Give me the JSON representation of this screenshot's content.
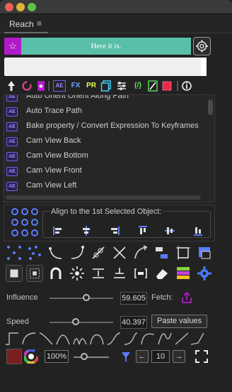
{
  "window": {
    "title_dots": [
      "close",
      "minimize",
      "zoom"
    ]
  },
  "panel": {
    "tab_label": "Reach",
    "menu_glyph": "≡"
  },
  "header": {
    "message": "Here it is.",
    "star_glyph": "☆"
  },
  "input": {
    "value": "",
    "placeholder": ""
  },
  "list": {
    "items": [
      "Auto Orient Orient Along Path",
      "Auto Trace Path",
      "Bake property / Convert Expression To Keyframes",
      "Cam View Back",
      "Cam View Bottom",
      "Cam View Front",
      "Cam View Left"
    ],
    "badge": "AE"
  },
  "toolbar": {
    "fx": "FX",
    "pr": "PR",
    "code": "{/}",
    "ae": "AE"
  },
  "align": {
    "label": "Align to the 1st Selected Object:"
  },
  "influence": {
    "label": "Influence",
    "value": "59.605",
    "level": 0.59
  },
  "fetch": {
    "label": "Fetch:"
  },
  "speed": {
    "label": "Speed",
    "value": "40.397",
    "level": 0.4
  },
  "paste": {
    "label": "Paste values"
  },
  "footer": {
    "zoom": "100%",
    "counter": "10",
    "prev": "←",
    "next": "→"
  },
  "colors": {
    "accent": "#b11ac8",
    "teal": "#5abfa8",
    "blue": "#5a7cff",
    "swatch": "#7a1f1f"
  }
}
